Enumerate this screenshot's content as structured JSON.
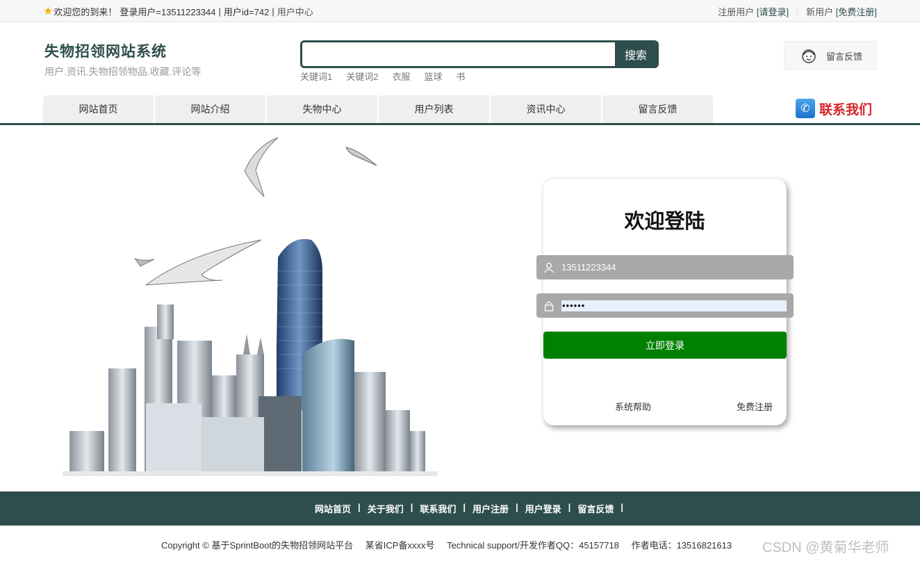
{
  "topbar": {
    "welcome": "欢迎您的到来！",
    "login_user": "登录用户=13511223344",
    "sep1": "|",
    "user_id": "用户id=742",
    "sep2": "|",
    "user_center": "用户中心",
    "register_label": "注册用户",
    "login_link": "[请登录]",
    "new_user_label": "新用户",
    "free_register_link": "[免费注册]"
  },
  "brand": {
    "title": "失物招领网站系统",
    "subtitle": "用户.资讯.失物招领物品.收藏.评论等"
  },
  "search": {
    "placeholder": "",
    "button": "搜索",
    "keywords": [
      "关键词1",
      "关键词2",
      "衣服",
      "篮球",
      "书"
    ]
  },
  "feedback_box": {
    "label": "留言反馈"
  },
  "nav": {
    "items": [
      "网站首页",
      "网站介绍",
      "失物中心",
      "用户列表",
      "资讯中心",
      "留言反馈"
    ],
    "contact": "联系我们"
  },
  "login": {
    "title": "欢迎登陆",
    "username": "13511223344",
    "password_mask": "••••••",
    "submit": "立即登录",
    "help": "系统帮助",
    "register": "免费注册"
  },
  "footer": {
    "links": [
      "网站首页",
      "关于我们",
      "联系我们",
      "用户注册",
      "用户登录",
      "留言反馈"
    ],
    "separator": "|",
    "copyright": "Copyright © 基于SprintBoot的失物招领网站平台",
    "icp": "某省ICP备xxxx号",
    "support": "Technical support/开发作者QQ：45157718",
    "phone": "作者电话：13516821613"
  },
  "watermark": "CSDN @黄菊华老师",
  "colors": {
    "primary": "#2d4e4c",
    "login_button": "#008000",
    "contact_red": "#d4242b"
  }
}
